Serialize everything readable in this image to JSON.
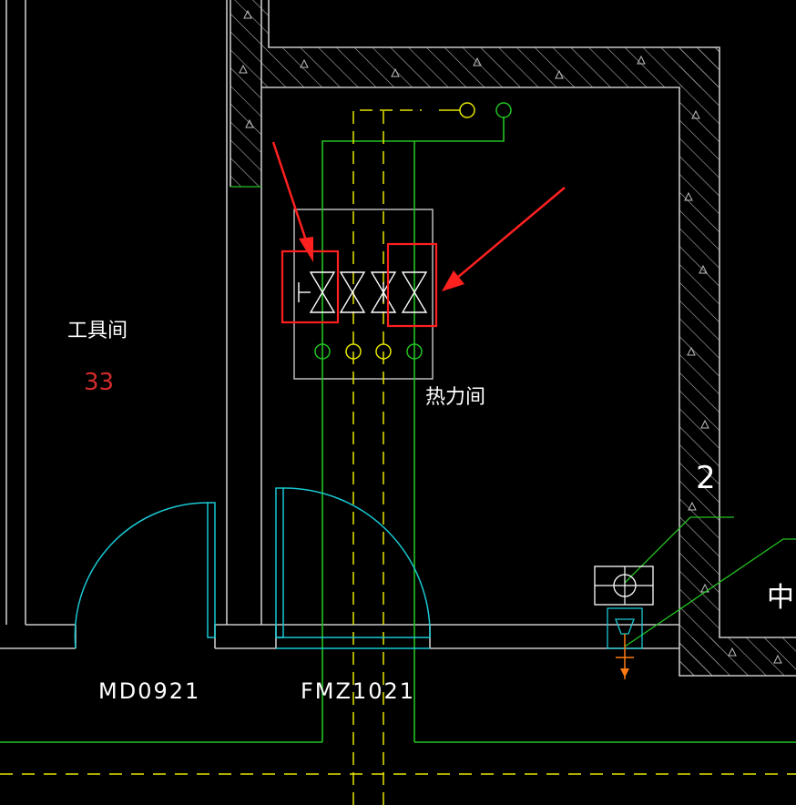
{
  "rooms": {
    "tool_room": {
      "name": "工具间",
      "number": "33"
    },
    "heat_room": {
      "name": "热力间"
    },
    "partial_room": {
      "name": "中"
    }
  },
  "doors": {
    "left_door": "MD0921",
    "right_door": "FMZ1021"
  },
  "axis": {
    "mark": "2"
  },
  "colors": {
    "background": "#000000",
    "wall": "#c8c8c8",
    "pipe_supply": "#22c422",
    "pipe_return": "#e6e600",
    "door_arc": "#19c8d2",
    "annotation": "#ff2020",
    "text": "#ffffff",
    "room_number": "#d22b2b",
    "valve": "#ffffff",
    "fitting": "#ff7a14"
  },
  "annotations": {
    "highlight_boxes": 2,
    "arrows": 2
  }
}
